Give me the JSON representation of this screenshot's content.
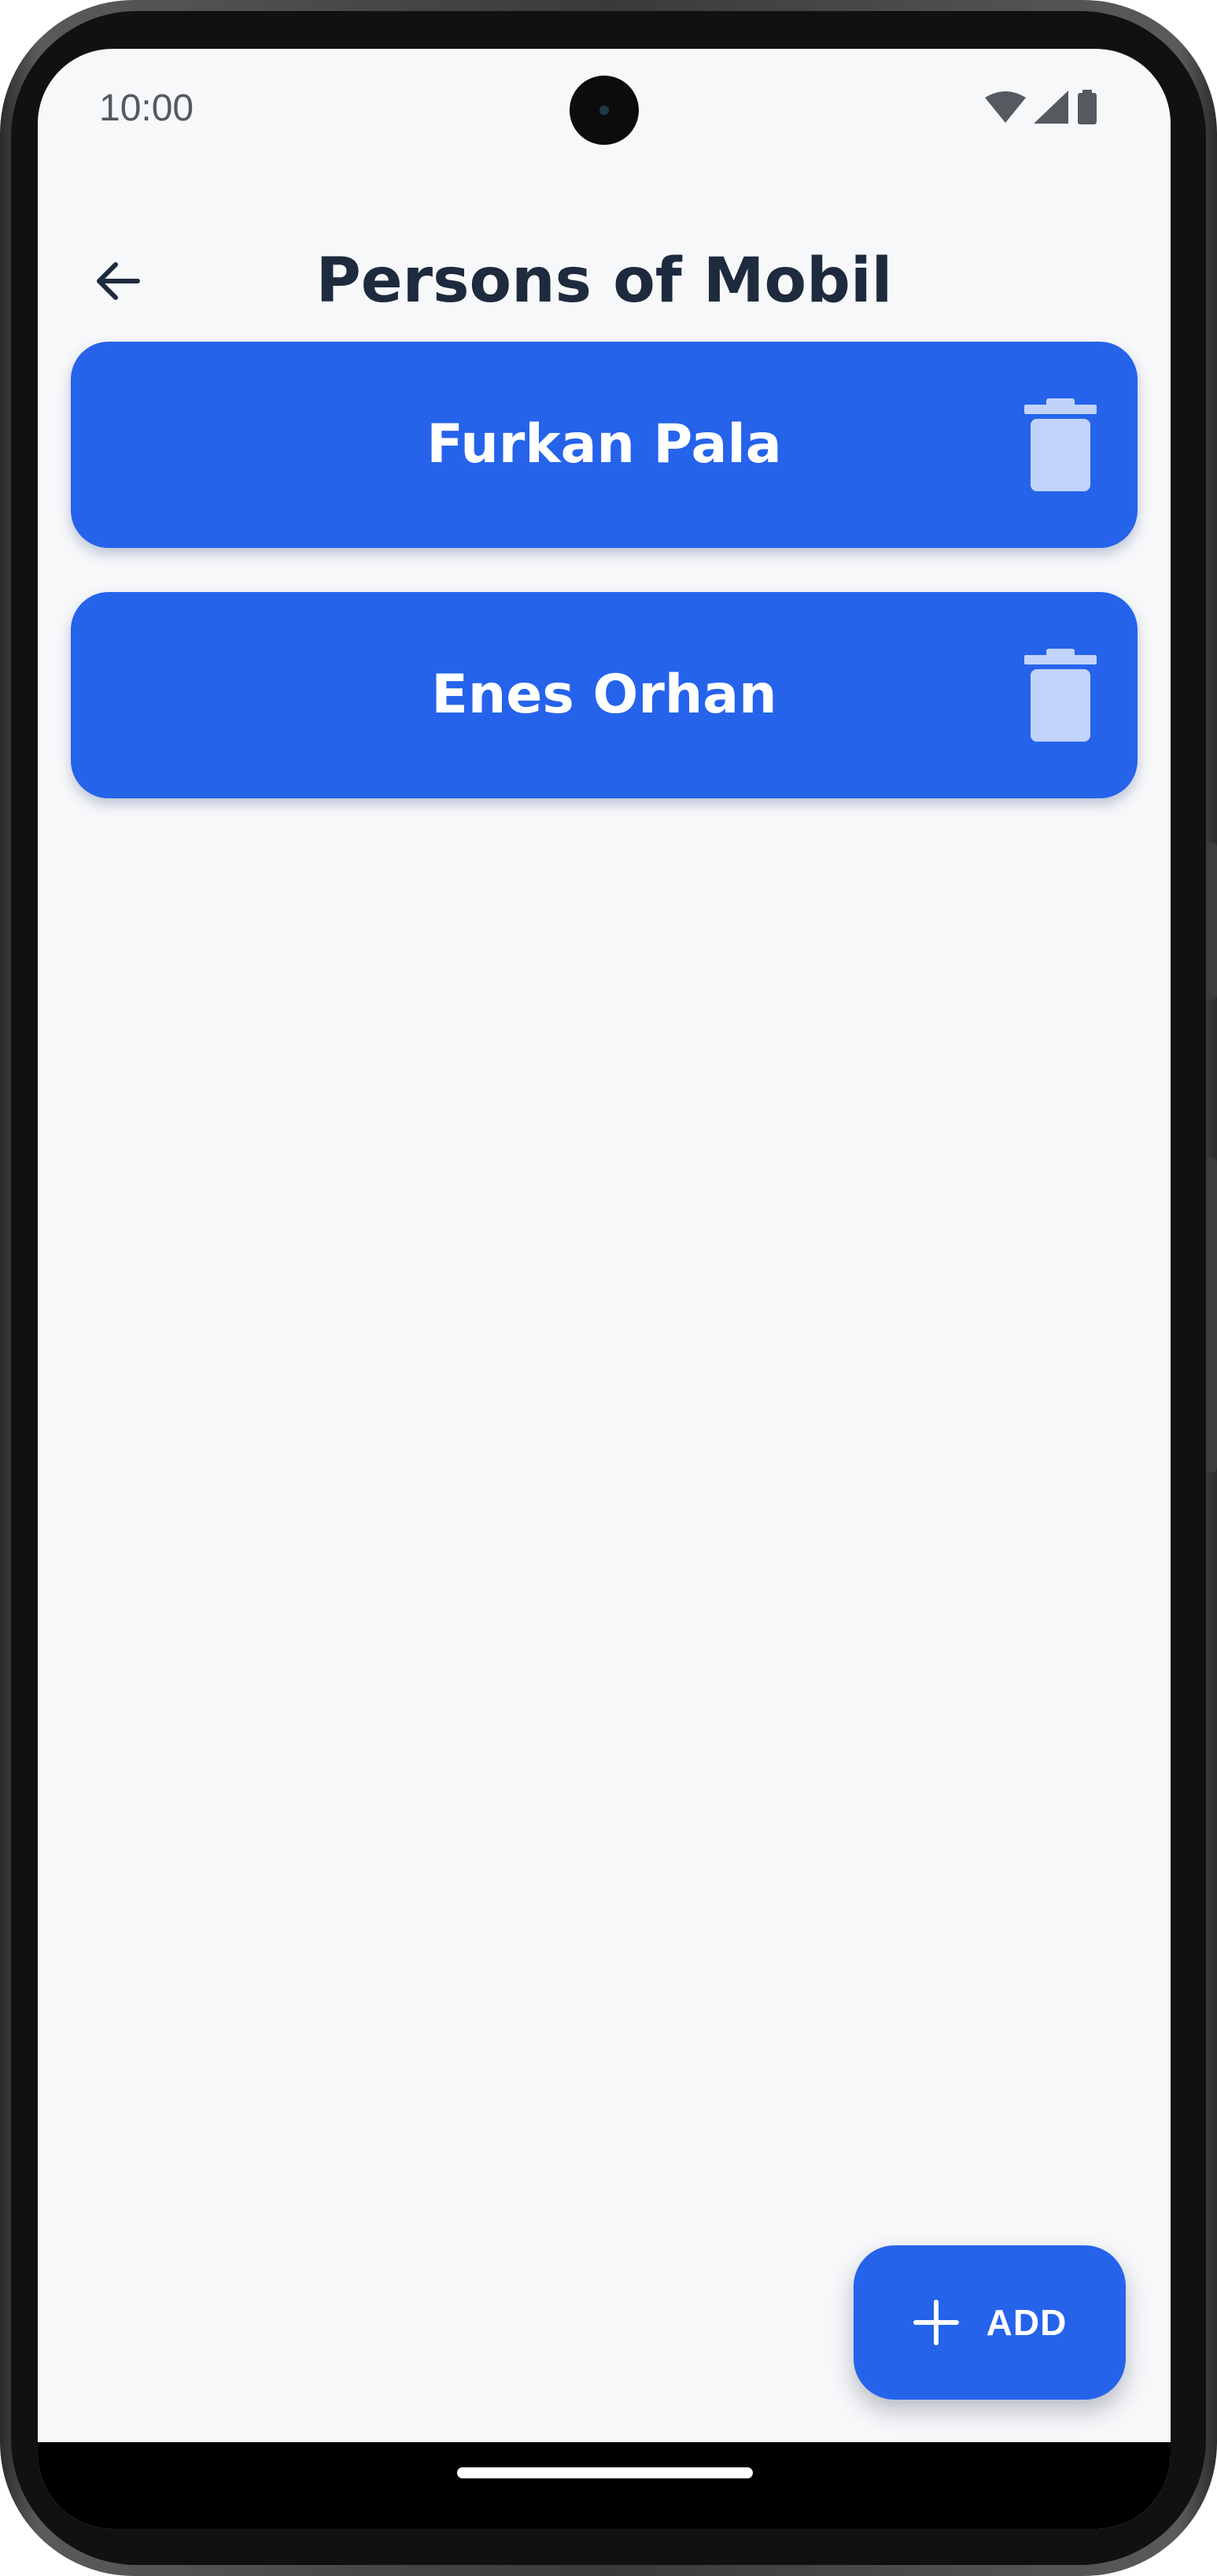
{
  "status_bar": {
    "time": "10:00",
    "icons": [
      "wifi-icon",
      "cellular-signal-icon",
      "battery-icon"
    ]
  },
  "app_bar": {
    "back_icon": "arrow-back-icon",
    "title": "Persons of Mobil"
  },
  "persons": [
    {
      "name": "Furkan Pala",
      "delete_icon": "trash-icon"
    },
    {
      "name": "Enes Orhan",
      "delete_icon": "trash-icon"
    }
  ],
  "fab": {
    "icon": "plus-icon",
    "label": "ADD"
  },
  "colors": {
    "background": "#f7f8fa",
    "accent": "#2563eb",
    "title_text": "#1e2a3d",
    "card_text": "#ffffff",
    "delete_icon": "#c2d3fb"
  }
}
